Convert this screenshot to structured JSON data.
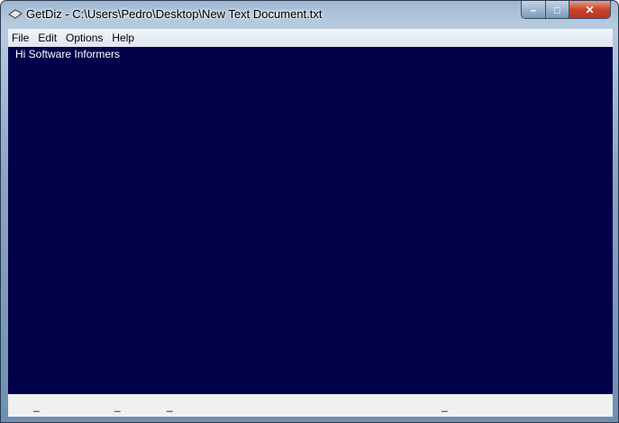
{
  "window": {
    "title": "GetDiz - C:\\Users\\Pedro\\Desktop\\New Text Document.txt",
    "minimize": "–",
    "maximize": "□",
    "close": "✕"
  },
  "menu": [
    "File",
    "Edit",
    "Options",
    "Help"
  ],
  "content": {
    "text": "Hi Software Informers"
  },
  "status": [
    "_",
    "_",
    "_",
    "_"
  ]
}
